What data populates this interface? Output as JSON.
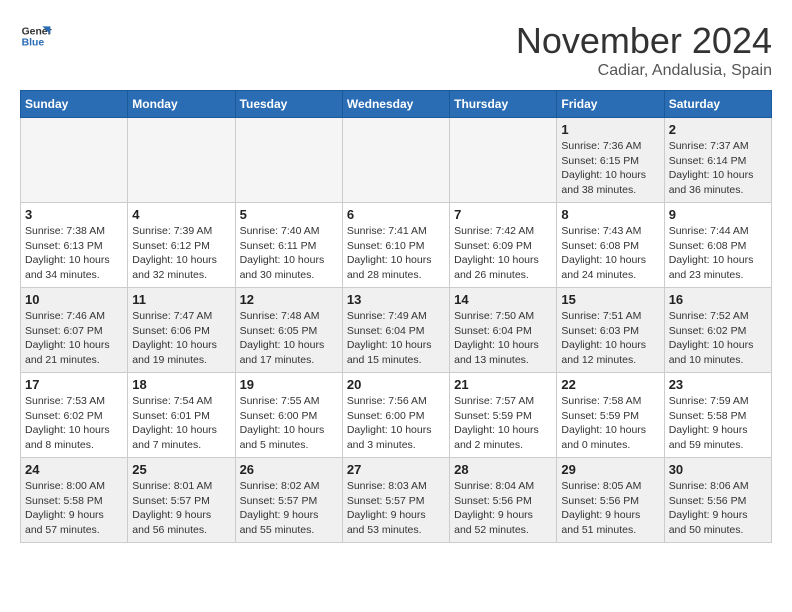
{
  "logo": {
    "line1": "General",
    "line2": "Blue"
  },
  "header": {
    "month": "November 2024",
    "location": "Cadiar, Andalusia, Spain"
  },
  "days_of_week": [
    "Sunday",
    "Monday",
    "Tuesday",
    "Wednesday",
    "Thursday",
    "Friday",
    "Saturday"
  ],
  "weeks": [
    [
      {
        "day": "",
        "info": ""
      },
      {
        "day": "",
        "info": ""
      },
      {
        "day": "",
        "info": ""
      },
      {
        "day": "",
        "info": ""
      },
      {
        "day": "",
        "info": ""
      },
      {
        "day": "1",
        "info": "Sunrise: 7:36 AM\nSunset: 6:15 PM\nDaylight: 10 hours and 38 minutes."
      },
      {
        "day": "2",
        "info": "Sunrise: 7:37 AM\nSunset: 6:14 PM\nDaylight: 10 hours and 36 minutes."
      }
    ],
    [
      {
        "day": "3",
        "info": "Sunrise: 7:38 AM\nSunset: 6:13 PM\nDaylight: 10 hours and 34 minutes."
      },
      {
        "day": "4",
        "info": "Sunrise: 7:39 AM\nSunset: 6:12 PM\nDaylight: 10 hours and 32 minutes."
      },
      {
        "day": "5",
        "info": "Sunrise: 7:40 AM\nSunset: 6:11 PM\nDaylight: 10 hours and 30 minutes."
      },
      {
        "day": "6",
        "info": "Sunrise: 7:41 AM\nSunset: 6:10 PM\nDaylight: 10 hours and 28 minutes."
      },
      {
        "day": "7",
        "info": "Sunrise: 7:42 AM\nSunset: 6:09 PM\nDaylight: 10 hours and 26 minutes."
      },
      {
        "day": "8",
        "info": "Sunrise: 7:43 AM\nSunset: 6:08 PM\nDaylight: 10 hours and 24 minutes."
      },
      {
        "day": "9",
        "info": "Sunrise: 7:44 AM\nSunset: 6:08 PM\nDaylight: 10 hours and 23 minutes."
      }
    ],
    [
      {
        "day": "10",
        "info": "Sunrise: 7:46 AM\nSunset: 6:07 PM\nDaylight: 10 hours and 21 minutes."
      },
      {
        "day": "11",
        "info": "Sunrise: 7:47 AM\nSunset: 6:06 PM\nDaylight: 10 hours and 19 minutes."
      },
      {
        "day": "12",
        "info": "Sunrise: 7:48 AM\nSunset: 6:05 PM\nDaylight: 10 hours and 17 minutes."
      },
      {
        "day": "13",
        "info": "Sunrise: 7:49 AM\nSunset: 6:04 PM\nDaylight: 10 hours and 15 minutes."
      },
      {
        "day": "14",
        "info": "Sunrise: 7:50 AM\nSunset: 6:04 PM\nDaylight: 10 hours and 13 minutes."
      },
      {
        "day": "15",
        "info": "Sunrise: 7:51 AM\nSunset: 6:03 PM\nDaylight: 10 hours and 12 minutes."
      },
      {
        "day": "16",
        "info": "Sunrise: 7:52 AM\nSunset: 6:02 PM\nDaylight: 10 hours and 10 minutes."
      }
    ],
    [
      {
        "day": "17",
        "info": "Sunrise: 7:53 AM\nSunset: 6:02 PM\nDaylight: 10 hours and 8 minutes."
      },
      {
        "day": "18",
        "info": "Sunrise: 7:54 AM\nSunset: 6:01 PM\nDaylight: 10 hours and 7 minutes."
      },
      {
        "day": "19",
        "info": "Sunrise: 7:55 AM\nSunset: 6:00 PM\nDaylight: 10 hours and 5 minutes."
      },
      {
        "day": "20",
        "info": "Sunrise: 7:56 AM\nSunset: 6:00 PM\nDaylight: 10 hours and 3 minutes."
      },
      {
        "day": "21",
        "info": "Sunrise: 7:57 AM\nSunset: 5:59 PM\nDaylight: 10 hours and 2 minutes."
      },
      {
        "day": "22",
        "info": "Sunrise: 7:58 AM\nSunset: 5:59 PM\nDaylight: 10 hours and 0 minutes."
      },
      {
        "day": "23",
        "info": "Sunrise: 7:59 AM\nSunset: 5:58 PM\nDaylight: 9 hours and 59 minutes."
      }
    ],
    [
      {
        "day": "24",
        "info": "Sunrise: 8:00 AM\nSunset: 5:58 PM\nDaylight: 9 hours and 57 minutes."
      },
      {
        "day": "25",
        "info": "Sunrise: 8:01 AM\nSunset: 5:57 PM\nDaylight: 9 hours and 56 minutes."
      },
      {
        "day": "26",
        "info": "Sunrise: 8:02 AM\nSunset: 5:57 PM\nDaylight: 9 hours and 55 minutes."
      },
      {
        "day": "27",
        "info": "Sunrise: 8:03 AM\nSunset: 5:57 PM\nDaylight: 9 hours and 53 minutes."
      },
      {
        "day": "28",
        "info": "Sunrise: 8:04 AM\nSunset: 5:56 PM\nDaylight: 9 hours and 52 minutes."
      },
      {
        "day": "29",
        "info": "Sunrise: 8:05 AM\nSunset: 5:56 PM\nDaylight: 9 hours and 51 minutes."
      },
      {
        "day": "30",
        "info": "Sunrise: 8:06 AM\nSunset: 5:56 PM\nDaylight: 9 hours and 50 minutes."
      }
    ]
  ]
}
